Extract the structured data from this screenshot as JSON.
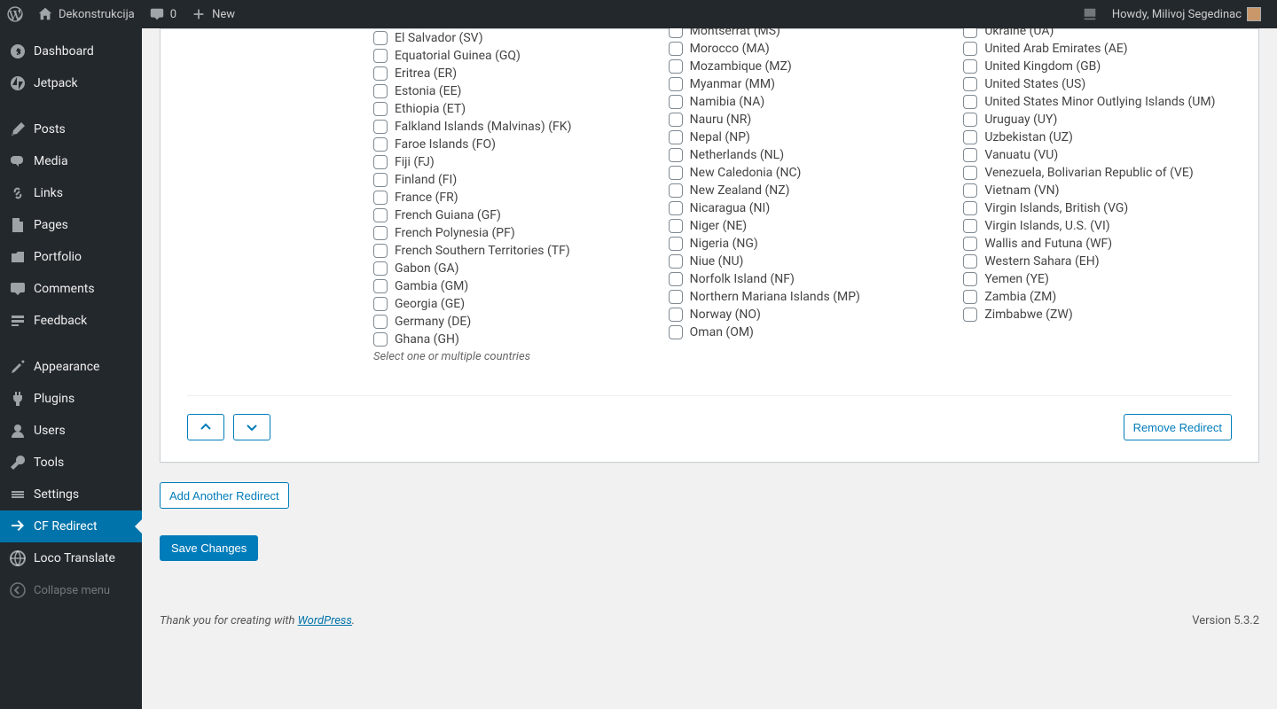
{
  "adminbar": {
    "site_name": "Dekonstrukcija",
    "comment_count": "0",
    "new_label": "New",
    "howdy": "Howdy, Milivoj Segedinac"
  },
  "sidebar": {
    "dashboard": "Dashboard",
    "jetpack": "Jetpack",
    "posts": "Posts",
    "media": "Media",
    "links": "Links",
    "pages": "Pages",
    "portfolio": "Portfolio",
    "comments": "Comments",
    "feedback": "Feedback",
    "appearance": "Appearance",
    "plugins": "Plugins",
    "users": "Users",
    "tools": "Tools",
    "settings": "Settings",
    "cf_redirect": "CF Redirect",
    "loco": "Loco Translate",
    "collapse": "Collapse menu"
  },
  "countries": {
    "col1": [
      "El Salvador (SV)",
      "Equatorial Guinea (GQ)",
      "Eritrea (ER)",
      "Estonia (EE)",
      "Ethiopia (ET)",
      "Falkland Islands (Malvinas) (FK)",
      "Faroe Islands (FO)",
      "Fiji (FJ)",
      "Finland (FI)",
      "France (FR)",
      "French Guiana (GF)",
      "French Polynesia (PF)",
      "French Southern Territories (TF)",
      "Gabon (GA)",
      "Gambia (GM)",
      "Georgia (GE)",
      "Germany (DE)",
      "Ghana (GH)"
    ],
    "col2": [
      "Montserrat (MS)",
      "Morocco (MA)",
      "Mozambique (MZ)",
      "Myanmar (MM)",
      "Namibia (NA)",
      "Nauru (NR)",
      "Nepal (NP)",
      "Netherlands (NL)",
      "New Caledonia (NC)",
      "New Zealand (NZ)",
      "Nicaragua (NI)",
      "Niger (NE)",
      "Nigeria (NG)",
      "Niue (NU)",
      "Norfolk Island (NF)",
      "Northern Mariana Islands (MP)",
      "Norway (NO)",
      "Oman (OM)"
    ],
    "col3": [
      "Ukraine (UA)",
      "United Arab Emirates (AE)",
      "United Kingdom (GB)",
      "United States (US)",
      "United States Minor Outlying Islands (UM)",
      "Uruguay (UY)",
      "Uzbekistan (UZ)",
      "Vanuatu (VU)",
      "Venezuela, Bolivarian Republic of (VE)",
      "Vietnam (VN)",
      "Virgin Islands, British (VG)",
      "Virgin Islands, U.S. (VI)",
      "Wallis and Futuna (WF)",
      "Western Sahara (EH)",
      "Yemen (YE)",
      "Zambia (ZM)",
      "Zimbabwe (ZW)"
    ],
    "help": "Select one or multiple countries"
  },
  "buttons": {
    "remove_redirect": "Remove Redirect",
    "add_redirect": "Add Another Redirect",
    "save_changes": "Save Changes"
  },
  "footer": {
    "thank_you_prefix": "Thank you for creating with ",
    "wordpress": "WordPress",
    "suffix": ".",
    "version": "Version 5.3.2"
  }
}
